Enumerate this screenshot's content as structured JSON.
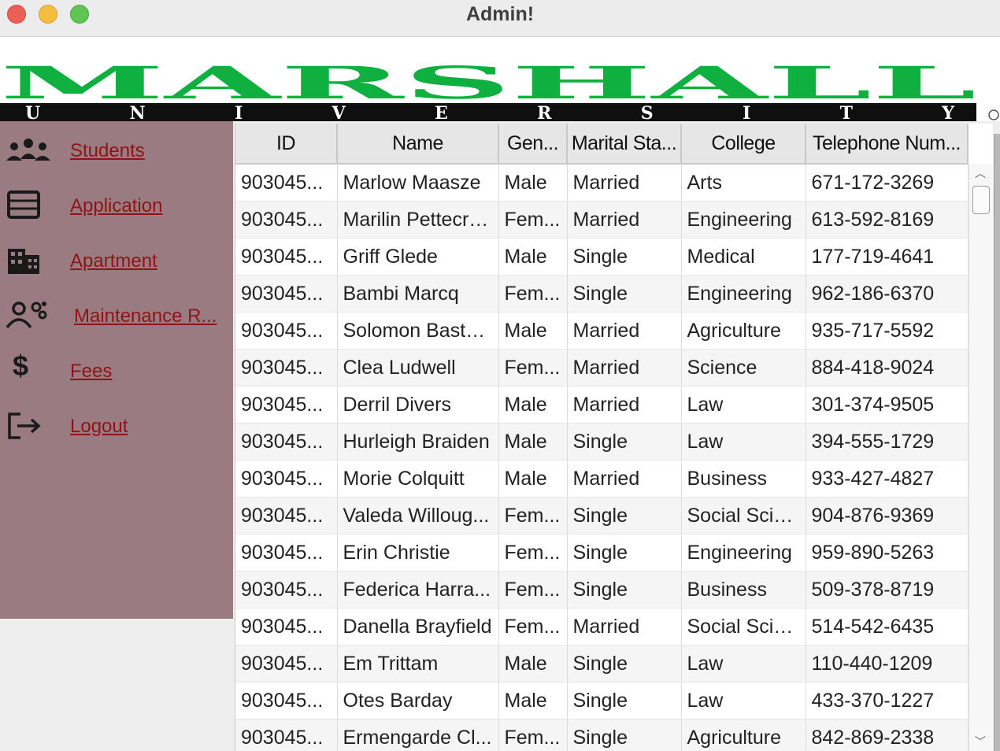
{
  "window": {
    "title": "Admin!"
  },
  "banner": {
    "word": "MARSHALL",
    "subword": "U N I V E R S I T Y",
    "green": "#10b040",
    "black": "#0f0f0f"
  },
  "sidebar": {
    "background": "#9a7b82",
    "link_color": "#8f1416",
    "items": [
      {
        "label": "Students",
        "icon": "people-group-icon"
      },
      {
        "label": "Application",
        "icon": "form-list-icon"
      },
      {
        "label": "Apartment",
        "icon": "building-icon"
      },
      {
        "label": "Maintenance R...",
        "icon": "worker-gear-icon"
      },
      {
        "label": "Fees",
        "icon": "dollar-icon",
        "glyph": "$"
      },
      {
        "label": "Logout",
        "icon": "logout-icon"
      }
    ]
  },
  "table": {
    "columns": [
      "ID",
      "Name",
      "Gen...",
      "Marital Sta...",
      "College",
      "Telephone Num..."
    ],
    "rows": [
      [
        "903045...",
        "Marlow Maasze",
        "Male",
        "Married",
        "Arts",
        "671-172-3269"
      ],
      [
        "903045...",
        "Marilin Pettecrew",
        "Fem...",
        "Married",
        "Engineering",
        "613-592-8169"
      ],
      [
        "903045...",
        "Griff Glede",
        "Male",
        "Single",
        "Medical",
        "177-719-4641"
      ],
      [
        "903045...",
        "Bambi Marcq",
        "Fem...",
        "Single",
        "Engineering",
        "962-186-6370"
      ],
      [
        "903045...",
        "Solomon Bastone",
        "Male",
        "Married",
        "Agriculture",
        "935-717-5592"
      ],
      [
        "903045...",
        "Clea Ludwell",
        "Fem...",
        "Married",
        "Science",
        "884-418-9024"
      ],
      [
        "903045...",
        "Derril Divers",
        "Male",
        "Married",
        "Law",
        "301-374-9505"
      ],
      [
        "903045...",
        "Hurleigh Braiden",
        "Male",
        "Single",
        "Law",
        "394-555-1729"
      ],
      [
        "903045...",
        "Morie Colquitt",
        "Male",
        "Married",
        "Business",
        "933-427-4827"
      ],
      [
        "903045...",
        "Valeda Willoug...",
        "Fem...",
        "Single",
        "Social Scie...",
        "904-876-9369"
      ],
      [
        "903045...",
        "Erin Christie",
        "Fem...",
        "Single",
        "Engineering",
        "959-890-5263"
      ],
      [
        "903045...",
        "Federica Harra...",
        "Fem...",
        "Single",
        "Business",
        "509-378-8719"
      ],
      [
        "903045...",
        "Danella Brayfield",
        "Fem...",
        "Married",
        "Social Scie...",
        "514-542-6435"
      ],
      [
        "903045...",
        "Em Trittam",
        "Male",
        "Single",
        "Law",
        "110-440-1209"
      ],
      [
        "903045...",
        "Otes Barday",
        "Male",
        "Single",
        "Law",
        "433-370-1227"
      ],
      [
        "903045...",
        "Ermengarde Cl...",
        "Fem...",
        "Single",
        "Agriculture",
        "842-869-2338"
      ]
    ]
  },
  "scrollbar": {
    "up_glyph": "︿",
    "down_glyph": "﹀"
  }
}
